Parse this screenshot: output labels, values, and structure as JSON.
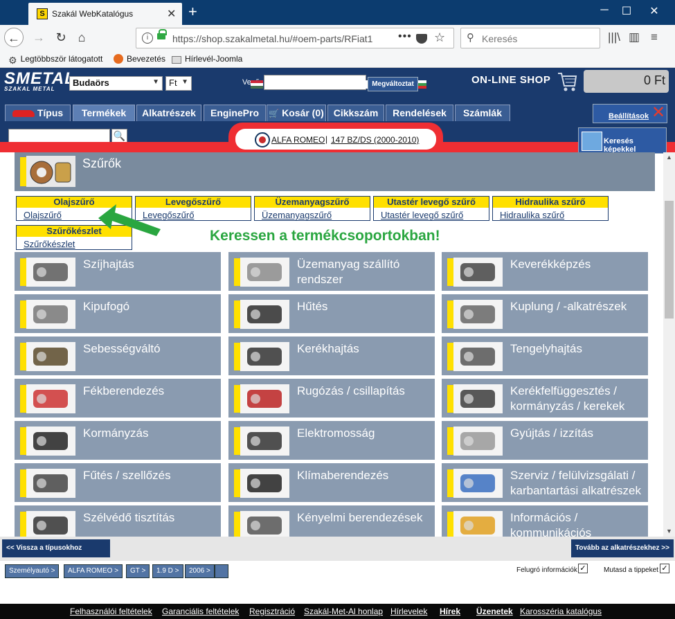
{
  "browser": {
    "tab_title": "Szakál WebKatalógus",
    "url": "https://shop.szakalmetal.hu/#oem-parts/RFiat1",
    "search_placeholder": "Keresés",
    "bookmarks": [
      "Legtöbbször látogatott",
      "Bevezetés",
      "Hírlevél-Joomla"
    ]
  },
  "header": {
    "logo": "SMETAL",
    "logo_sub": "SZAKAL METAL",
    "location": "Budaörs",
    "currency": "Ft",
    "vevo_label": "Vevő",
    "change_button": "Megváltoztat",
    "online_shop": "ON-LINE SHOP",
    "cart_amount": "0 Ft",
    "settings_label": "Beállítások",
    "image_search_label": "Keresés képekkel"
  },
  "menu": {
    "tabs": [
      "Típus",
      "Termékek",
      "Alkatrészek",
      "EnginePro",
      "Kosár (0)",
      "Cikkszám",
      "Rendelések",
      "Számlák"
    ]
  },
  "breadcrumb": {
    "brand": "ALFA ROMEO",
    "model": "147 BZ/DS (2000-2010)"
  },
  "section": {
    "title": "Szűrők"
  },
  "filters": [
    {
      "title": "Olajszűrő",
      "link": "Olajszűrő"
    },
    {
      "title": "Levegőszűrő",
      "link": "Levegőszűrő"
    },
    {
      "title": "Üzemanyagszűrő",
      "link": "Üzemanyagszűrő"
    },
    {
      "title": "Utastér levegő szűrő",
      "link": "Utastér levegő szűrő"
    },
    {
      "title": "Hidraulika szűrő",
      "link": "Hidraulika szűrő"
    },
    {
      "title": "Szűrőkészlet",
      "link": "Szűrőkészlet"
    }
  ],
  "promo": "Keressen a termékcsoportokban!",
  "categories": [
    "Szíjhajtás",
    "Üzemanyag szállító rendszer",
    "Keverékképzés",
    "Kipufogó",
    "Hűtés",
    "Kuplung / -alkatrészek",
    "Sebességváltó",
    "Kerékhajtás",
    "Tengelyhajtás",
    "Fékberendezés",
    "Rugózás / csillapítás",
    "Kerékfelfüggesztés / kormányzás / kerekek",
    "Kormányzás",
    "Elektromosság",
    "Gyújtás / izzítás",
    "Fűtés / szellőzés",
    "Klímaberendezés",
    "Szerviz / felülvizsgálati / karbantartási alkatrészek",
    "Szélvédő tisztítás",
    "Kényelmi berendezések",
    "Információs / kommunikációs"
  ],
  "nav": {
    "back": "<< Vissza a típusokhoz",
    "forward": "Tovább az alkatrészekhez >>"
  },
  "crumbs": [
    "Személyautó >",
    "ALFA ROMEO >",
    "GT >",
    "1.9 D >",
    "2006 >"
  ],
  "options": {
    "popup_info": "Felugró információk",
    "show_tips": "Mutasd a tippeket"
  },
  "footer": [
    "Felhasználói feltételek",
    "Garanciális feltételek",
    "Regisztráció",
    "Szakál-Met-Al honlap",
    "Hírlevelek",
    "Hírek",
    "Üzenetek",
    "Karosszéria katalógus"
  ],
  "colors": {
    "header_bg": "#1a3a6d",
    "accent_red": "#ef2e33",
    "accent_yellow": "#ffe000",
    "category_bg": "#8a9bb0",
    "promo_green": "#2aa640"
  }
}
